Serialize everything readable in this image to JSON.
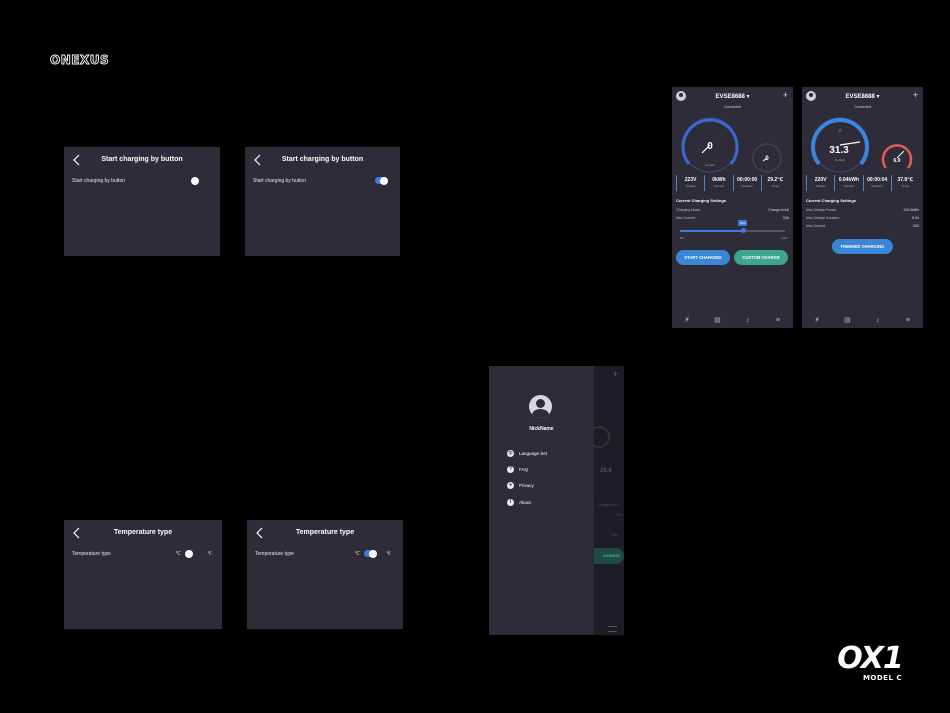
{
  "brand": {
    "name": "ONEXUS"
  },
  "model": {
    "name": "OX1",
    "sub": "MODEL C"
  },
  "charging_button": {
    "title": "Start charging by button",
    "row_label": "Start charging by button",
    "off_state": "off",
    "on_state": "on"
  },
  "temperature": {
    "title": "Temperature type",
    "row_label": "Temperature type",
    "unit_c": "℃",
    "unit_f": "℉"
  },
  "evse_idle": {
    "device": "EVSE8688 ▾",
    "connected": "Connected",
    "main_value": "0",
    "main_unit": "A",
    "main_label": "Current",
    "small_value": "0",
    "small_label": "Temp",
    "stats": [
      {
        "value": "223V",
        "label": "Voltage"
      },
      {
        "value": "0kWh",
        "label": "Amount"
      },
      {
        "value": "00:00:00",
        "label": "Duration"
      },
      {
        "value": "29.2℃",
        "label": "Temp"
      }
    ],
    "settings_title": "Current Charging Settings",
    "settings": [
      {
        "label": "Charging Mode",
        "value": "Charge to full"
      },
      {
        "label": "Max Current",
        "value": "32A"
      }
    ],
    "slider": {
      "value": 32,
      "tip": "32A",
      "min": "6A",
      "max": "32A",
      "fraction": 0.6
    },
    "start_button": "START CHARGING",
    "custom_button": "CUSTOM CHARGE"
  },
  "evse_charging": {
    "device": "EVSE8688 ▾",
    "connected": "Connected",
    "main_value": "31.3",
    "main_unit": "A",
    "main_label": "Current",
    "small_value": "6.9",
    "small_label": "kW",
    "stats": [
      {
        "value": "220V",
        "label": "Voltage"
      },
      {
        "value": "0.04kWh",
        "label": "Amount"
      },
      {
        "value": "00:00:04",
        "label": "Duration"
      },
      {
        "value": "37.8℃",
        "label": "Temp"
      }
    ],
    "settings_title": "Current Charging Settings",
    "settings": [
      {
        "label": "Max Charge Power",
        "value": "100.0kWh"
      },
      {
        "label": "Max Charge Duration",
        "value": "8.0h"
      },
      {
        "label": "Max Current",
        "value": "32A"
      }
    ],
    "finish_button": "FINISHED CHARGING"
  },
  "drawer": {
    "nickname": "NickName",
    "items": [
      {
        "label": "Language Set",
        "icon": "globe-icon"
      },
      {
        "label": "FAQ",
        "icon": "chat-icon"
      },
      {
        "label": "Privacy",
        "icon": "shield-icon"
      },
      {
        "label": "About",
        "icon": "info-icon"
      }
    ],
    "behind_value": "29.6",
    "behind_setting": "Charge to full",
    "behind_current": "32A",
    "behind_max": "32A",
    "behind_button": "CHARGE"
  },
  "colors": {
    "panel": "#2f2c3a",
    "accent": "#3f7be0",
    "teal": "#3aa78e",
    "red": "#e05a5a"
  }
}
